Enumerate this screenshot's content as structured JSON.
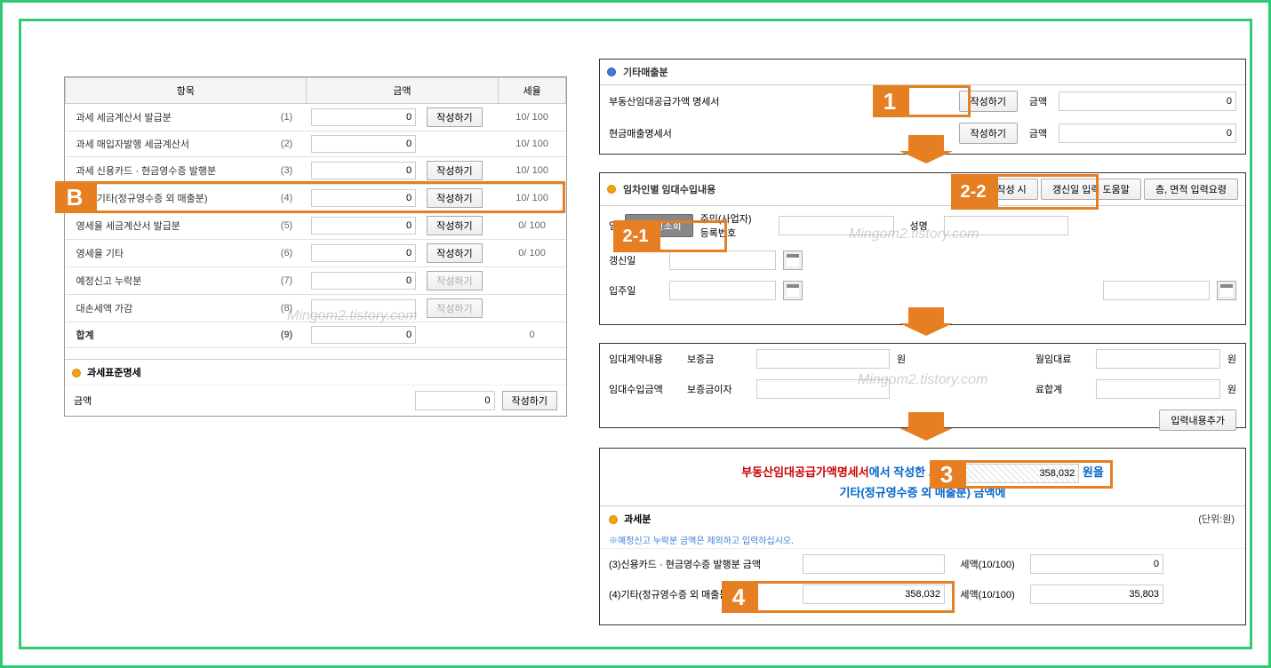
{
  "left": {
    "headers": {
      "item": "항목",
      "amount": "금액",
      "rate": "세율"
    },
    "rows": [
      {
        "label": "과세 세금계산서 발급분",
        "num": "(1)",
        "amount": "0",
        "btn": "작성하기",
        "rate": "10/ 100"
      },
      {
        "label": "과세 매입자발행 세금계산서",
        "num": "(2)",
        "amount": "0",
        "btn": "",
        "rate": "10/ 100"
      },
      {
        "label": "과세 신용카드 · 현금영수증 발행분",
        "num": "(3)",
        "amount": "0",
        "btn": "작성하기",
        "rate": "10/ 100"
      },
      {
        "label": "과세 기타(정규영수증 외 매출분)",
        "num": "(4)",
        "amount": "0",
        "btn": "작성하기",
        "rate": "10/ 100"
      },
      {
        "label": "영세율 세금계산서 발급분",
        "num": "(5)",
        "amount": "0",
        "btn": "작성하기",
        "rate": "0/ 100"
      },
      {
        "label": "영세율 기타",
        "num": "(6)",
        "amount": "0",
        "btn": "작성하기",
        "rate": "0/ 100"
      },
      {
        "label": "예정신고 누락분",
        "num": "(7)",
        "amount": "0",
        "btn": "작성하기",
        "rate": ""
      },
      {
        "label": "대손세액 가감",
        "num": "(8)",
        "amount": "",
        "btn": "작성하기",
        "rate": ""
      },
      {
        "label": "합계",
        "num": "(9)",
        "amount": "0",
        "btn": "",
        "rate": "0"
      }
    ],
    "sub_title": "과세표준명세",
    "sub_label": "금액",
    "sub_amount": "0",
    "sub_btn": "작성하기",
    "watermark": "Mingom2.tistory.com"
  },
  "box1": {
    "title": "기타매출분",
    "row1_label": "부동산임대공급가액 명세서",
    "row1_btn": "작성하기",
    "row1_amt_label": "금액",
    "row1_amt": "0",
    "row2_label": "현금매출명세서",
    "row2_btn": "작성하기",
    "row2_amt_label": "금액",
    "row2_amt": "0"
  },
  "box2": {
    "title": "임차인별 임대수입내용",
    "btn_write": "작성 시",
    "btn_help": "갱신일 입력 도움말",
    "btn_extra": "층, 면적 입력요령",
    "tenant_label": "임",
    "tenant_btn": "임차인조회",
    "resident_label": "주민(사업자)\n등록번호",
    "name_label": "성명",
    "renew_label": "갱신일",
    "movein_label": "입주일",
    "watermark": "Mingom2.tistory.com"
  },
  "box3": {
    "contract_label": "임대계약내용",
    "deposit_label": "보증금",
    "deposit_unit": "원",
    "rent_label": "월임대료",
    "rent_unit": "원",
    "income_label": "임대수입금액",
    "interest_label": "보증금이자",
    "sum_label": "료합계",
    "sum_unit": "원",
    "add_btn": "입력내용추가",
    "watermark": "Mingom2.tistory.com"
  },
  "box4": {
    "msg_red": "부동산임대공급가액명세서",
    "msg_mid": "에서 작성한 보증금",
    "msg_val": "358,032",
    "msg_suffix": "원을",
    "msg_line2": "기타(정규영수증 외 매출분) 금액에",
    "sec_title": "과세분",
    "sec_unit": "(단위:원)",
    "note": "※예정신고 누락분 금액은 제외하고 입력하십시오.",
    "r3_label": "(3)신용카드 · 현금영수증 발행분 금액",
    "r3_tax": "세액(10/100)",
    "r3_taxval": "0",
    "r4_label": "(4)기타(정규영수증 외 매출분) 금액",
    "r4_val": "358,032",
    "r4_tax": "세액(10/100)",
    "r4_taxval": "35,803"
  },
  "callouts": {
    "B": "B",
    "n1": "1",
    "n21": "2-1",
    "n22": "2-2",
    "n3": "3",
    "n4": "4"
  }
}
